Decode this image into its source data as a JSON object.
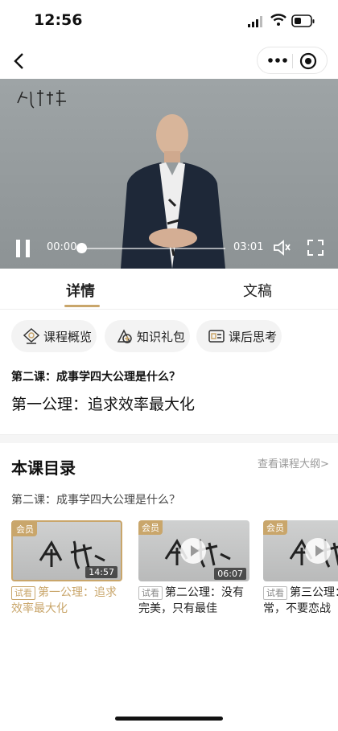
{
  "status": {
    "time": "12:56"
  },
  "player": {
    "current_time": "00:00",
    "total_time": "03:01",
    "progress": 0
  },
  "tabs": [
    {
      "label": "详情"
    },
    {
      "label": "文稿"
    }
  ],
  "chips": [
    {
      "label": "课程概览"
    },
    {
      "label": "知识礼包"
    },
    {
      "label": "课后思考"
    }
  ],
  "lesson": {
    "subtitle": "第二课：成事学四大公理是什么？",
    "title": "第一公理：追求效率最大化"
  },
  "catalog": {
    "title": "本课目录",
    "outline_link": "查看课程大纲>",
    "section": "第二课：成事学四大公理是什么？",
    "items": [
      {
        "badge": "会员",
        "duration": "14:57",
        "tag": "试看",
        "title": "第一公理：追求效率最大化"
      },
      {
        "badge": "会员",
        "duration": "06:07",
        "tag": "试看",
        "title": "第二公理：没有完美，只有最佳"
      },
      {
        "badge": "会员",
        "duration": "",
        "tag": "试看",
        "title": "第三公理：常，不要恋战"
      }
    ]
  },
  "colors": {
    "accent": "#c9a66b"
  }
}
